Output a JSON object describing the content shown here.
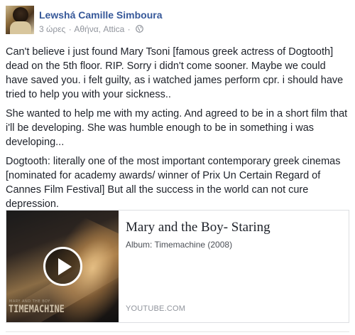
{
  "post": {
    "author": "Lewshá Camille Simboura",
    "time": "3 ώρες",
    "separator": "·",
    "location": "Αθήνα, Attica",
    "separator2": "·",
    "privacy_icon": "globe-icon",
    "paragraphs": [
      "Can't believe i just found Mary Tsoni [famous greek actress of Dogtooth] dead on the 5th floor. RIP. Sorry i didn't come sooner. Maybe we could have saved you. i felt guilty, as i watched james perform cpr. i should have tried to help you with your sickness..",
      "She wanted to help me with my acting. And agreed to be in a short film that i'll be developing. She was humble enough to be in something i was developing...",
      "Dogtooth: literally one of the most important contemporary greek cinemas [nominated for academy awards/ winner of Prix Un Certain Regard of Cannes Film Festival] But all the success in the world can not cure depression."
    ]
  },
  "link_card": {
    "title": "Mary and the Boy- Staring",
    "description": "Album: Timemachine (2008)",
    "domain": "YOUTUBE.COM",
    "thumbnail": {
      "small_text": "MARY AND THE BOY",
      "album_text": "TIMEMACHINE",
      "play_icon": "play-icon"
    }
  },
  "colors": {
    "author_link": "#365899",
    "meta_text": "#90949c",
    "body_text": "#1d2129",
    "card_border": "#dddfe2"
  }
}
